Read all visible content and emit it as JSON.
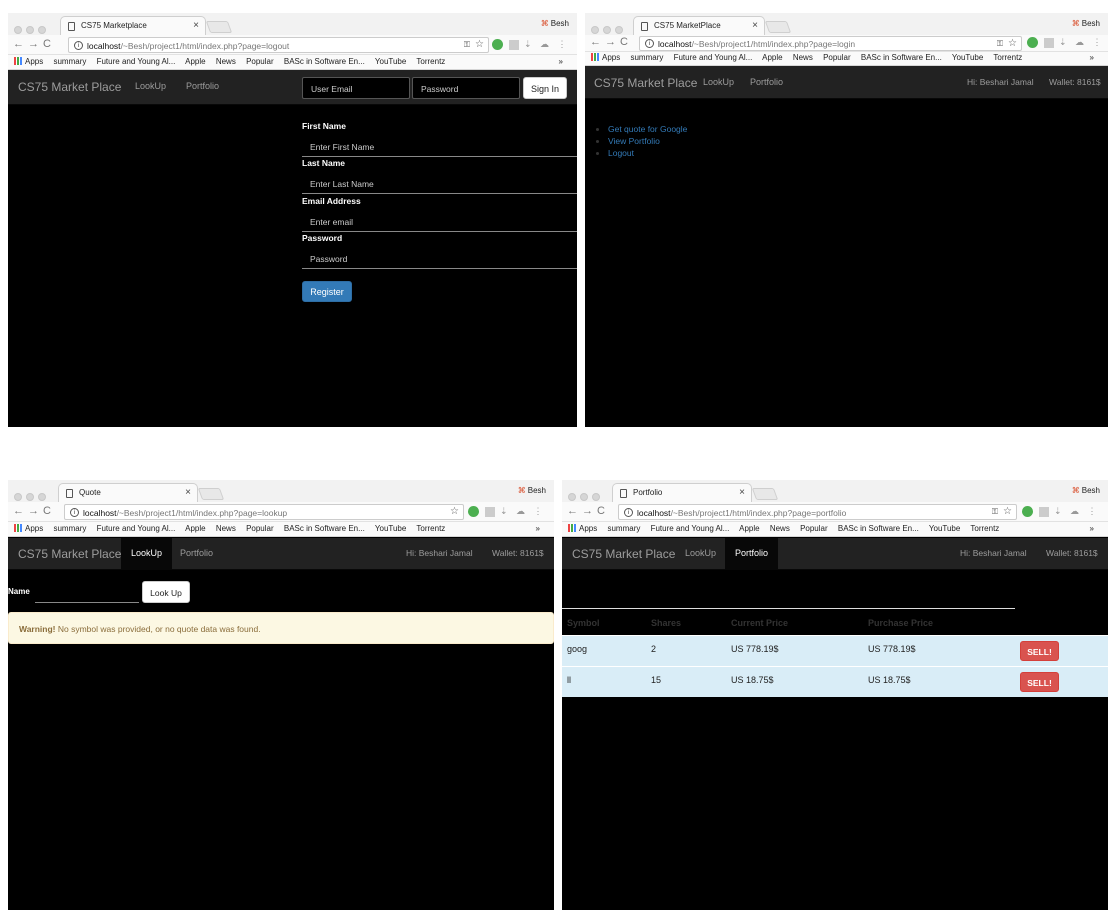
{
  "bookmarks": [
    "Apps",
    "summary",
    "Future and Young Al...",
    "Apple",
    "News",
    "Popular",
    "BASc in Software En...",
    "YouTube",
    "Torrentz"
  ],
  "bookmarks_more": "»",
  "profile_user": "Besh",
  "brand": "CS75 Market Place",
  "nav": {
    "lookup": "LookUp",
    "portfolio": "Portfolio"
  },
  "greeting": "Hi: Beshari Jamal",
  "wallet": "Wallet: 8161$",
  "win1": {
    "tab_title": "CS75 Marketplace",
    "url_host": "localhost",
    "url_path": "/~Besh/project1/html/index.php?page=logout",
    "login": {
      "email_placeholder": "User Email",
      "password_placeholder": "Password",
      "signin": "Sign In"
    },
    "register": {
      "first_label": "First Name",
      "first_ph": "Enter First Name",
      "last_label": "Last Name",
      "last_ph": "Enter Last Name",
      "email_label": "Email Address",
      "email_ph": "Enter email",
      "pass_label": "Password",
      "pass_ph": "Password",
      "submit": "Register"
    }
  },
  "win2": {
    "tab_title": "CS75 MarketPlace",
    "url_host": "localhost",
    "url_path": "/~Besh/project1/html/index.php?page=login",
    "menu": [
      "Get quote for Google",
      "View Portfolio",
      "Logout"
    ]
  },
  "win3": {
    "tab_title": "Quote",
    "url_host": "localhost",
    "url_path": "/~Besh/project1/html/index.php?page=lookup",
    "name_label": "Name",
    "lookup_button": "Look Up",
    "warning_strong": "Warning!",
    "warning_text": " No symbol was provided, or no quote data was found."
  },
  "win4": {
    "tab_title": "Portfolio",
    "url_host": "localhost",
    "url_path": "/~Besh/project1/html/index.php?page=portfolio",
    "columns": [
      "Symbol",
      "Shares",
      "Current Price",
      "Purchase Price"
    ],
    "rows": [
      {
        "symbol": "goog",
        "shares": "2",
        "current": "US 778.19$",
        "purchase": "US 778.19$",
        "action": "SELL!"
      },
      {
        "symbol": "ll",
        "shares": "15",
        "current": "US 18.75$",
        "purchase": "US 18.75$",
        "action": "SELL!"
      }
    ]
  }
}
